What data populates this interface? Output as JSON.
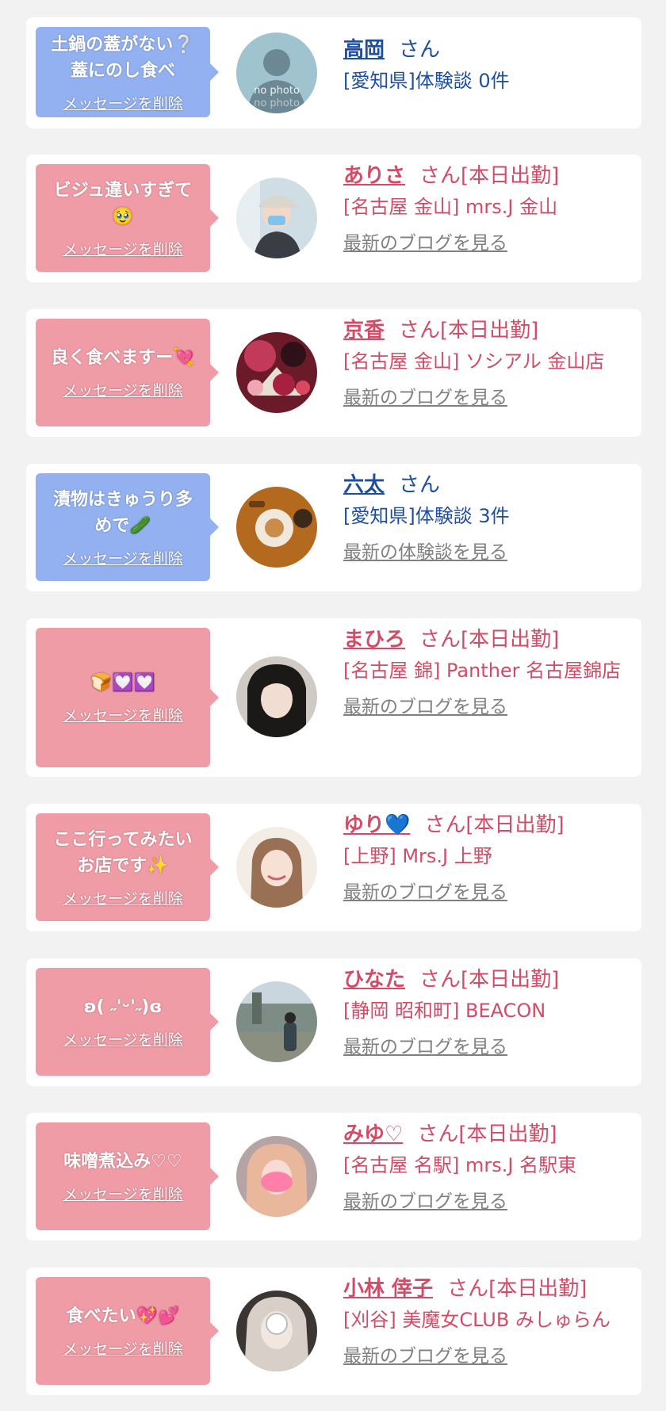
{
  "delete_label": "メッセージを削除",
  "suffix_plain": "さん",
  "suffix_shift": "さん[本日出勤]",
  "latest_blog": "最新のブログを見る",
  "latest_review": "最新の体験談を見る",
  "colors": {
    "page_bg": "#f2f2f2",
    "bubble_user": "#93b1f0",
    "bubble_cast": "#f09ca7",
    "user_text": "#1d4e9f",
    "cast_text": "#d24b67",
    "link_gray": "#808080"
  },
  "items": [
    {
      "type": "user",
      "message_lines": [
        "土鍋の蓋がない❔",
        "蓋にのし食べ"
      ],
      "avatar": "no-photo-avatar",
      "avatar_text": [
        "no photo",
        "no photo"
      ],
      "name": "高岡",
      "detail": "[愛知県]体験談 0件",
      "latest": ""
    },
    {
      "type": "cast",
      "message_lines": [
        "ビジュ違いすぎて",
        "🥹"
      ],
      "avatar": "cap-mask-avatar",
      "name": "ありさ",
      "detail": "[名古屋 金山] mrs.J 金山",
      "latest": "最新のブログを見る"
    },
    {
      "type": "cast",
      "message_lines": [
        "良く食べますー💘"
      ],
      "avatar": "kimono-fan-avatar",
      "name": "京香",
      "detail": "[名古屋 金山] ソシアル 金山店",
      "latest": "最新のブログを見る"
    },
    {
      "type": "user",
      "message_lines": [
        "漬物はきゅうり多",
        "めで🥒"
      ],
      "avatar": "food-table-avatar",
      "name": "六太",
      "detail": "[愛知県]体験談 3件",
      "latest": "最新の体験談を見る"
    },
    {
      "type": "cast",
      "message_lines": [
        "🍞💟💟"
      ],
      "avatar": "bangs-girl-avatar",
      "name": "まひろ",
      "detail": "[名古屋 錦] Panther 名古屋錦店",
      "latest": "最新のブログを見る"
    },
    {
      "type": "cast",
      "message_lines": [
        "ここ行ってみたい",
        "お店です✨"
      ],
      "avatar": "smiling-girl-avatar",
      "name": "ゆり",
      "name_heart": "💙",
      "detail": "[上野] Mrs.J 上野",
      "latest": "最新のブログを見る"
    },
    {
      "type": "cast",
      "message_lines": [
        "ʚ( ˶'ᵕ'˶)ɞ"
      ],
      "avatar": "street-photo-avatar",
      "name": "ひなた",
      "detail": "[静岡 昭和町] BEACON",
      "latest": "最新のブログを見る"
    },
    {
      "type": "cast",
      "message_lines": [
        "味噌煮込み♡♡"
      ],
      "avatar": "pink-mask-avatar",
      "name": "みゆ♡",
      "detail": "[名古屋 名駅] mrs.J 名駅東",
      "latest": "最新のブログを見る"
    },
    {
      "type": "cast",
      "message_lines": [
        "食べたい💖💕"
      ],
      "avatar": "blurred-face-avatar",
      "name": "小林 倖子",
      "detail": "[刈谷] 美魔女CLUB みしゅらん",
      "latest": "最新のブログを見る"
    }
  ]
}
